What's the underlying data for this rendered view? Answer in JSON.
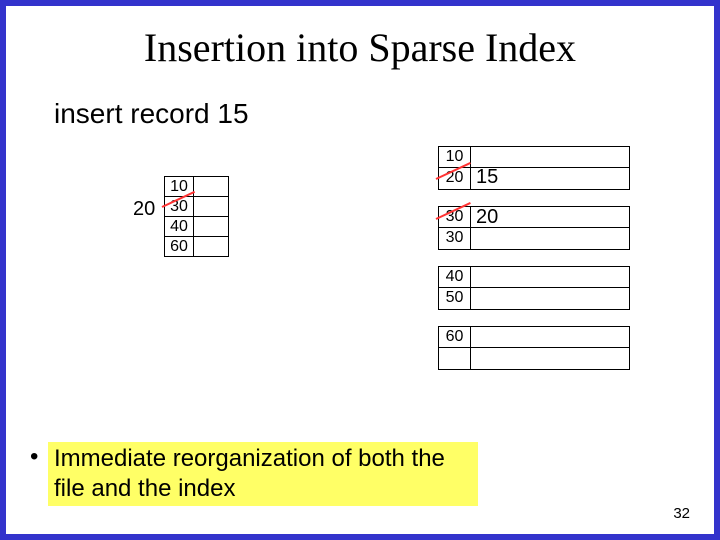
{
  "title": "Insertion into Sparse Index",
  "subtitle": "insert record 15",
  "index": {
    "left_new_value": "20",
    "rows": [
      "10",
      "30",
      "40",
      "60"
    ]
  },
  "data_blocks": [
    {
      "rows": [
        [
          "10",
          ""
        ],
        [
          "20",
          ""
        ]
      ],
      "new_right": "15",
      "strike_row": 1
    },
    {
      "rows": [
        [
          "30",
          ""
        ],
        [
          "30",
          ""
        ]
      ],
      "new_right": "20",
      "strike_row": 0
    },
    {
      "rows": [
        [
          "40",
          ""
        ],
        [
          "50",
          ""
        ]
      ]
    },
    {
      "rows": [
        [
          "60",
          ""
        ],
        [
          "",
          ""
        ]
      ]
    }
  ],
  "bullet": "Immediate reorganization of both the file and the index",
  "page_number": "32"
}
